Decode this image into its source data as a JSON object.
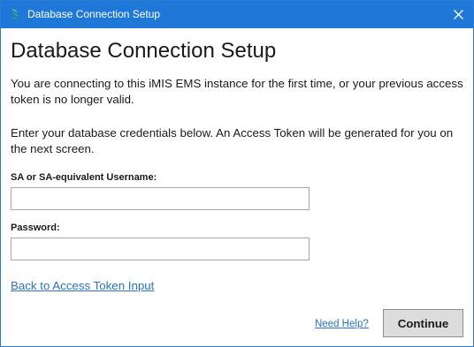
{
  "window": {
    "title": "Database Connection Setup",
    "accent_color": "#1f78d8"
  },
  "icons": {
    "app": "imis-logo-icon",
    "close": "close-icon"
  },
  "main": {
    "heading": "Database Connection Setup",
    "intro_text": "You are connecting to this iMIS EMS instance for the first time, or your previous access token is no longer valid.",
    "instructions_text": "Enter your database credentials below. An Access Token will be generated for you on the next screen."
  },
  "form": {
    "username_label": "SA or SA-equivalent Username:",
    "username_value": "",
    "password_label": "Password:",
    "password_value": ""
  },
  "links": {
    "back": "Back to Access Token Input",
    "help": "Need Help?",
    "link_color": "#2b72c6"
  },
  "buttons": {
    "continue": "Continue"
  }
}
